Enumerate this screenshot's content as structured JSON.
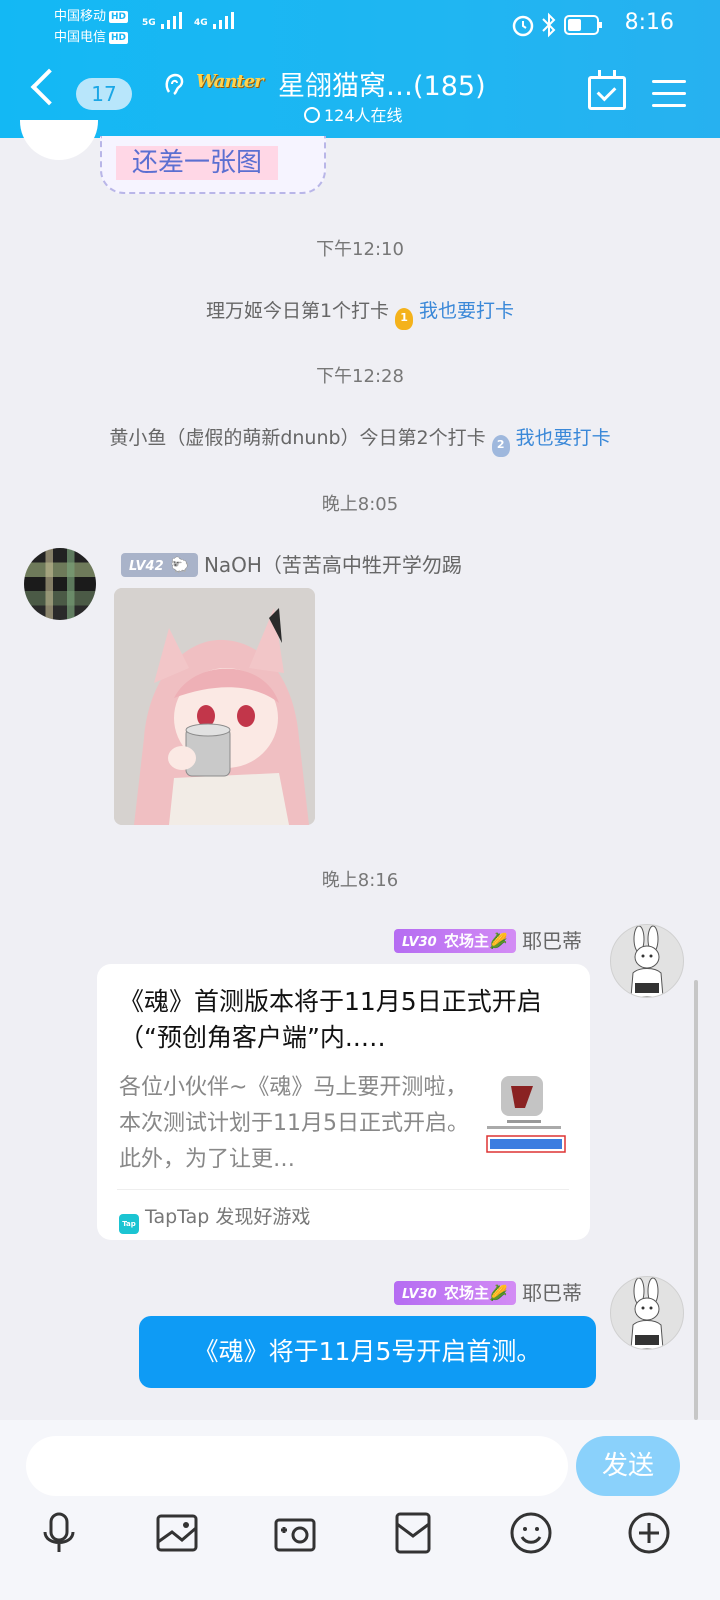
{
  "status_bar": {
    "carrier1": "中国移动",
    "carrier2": "中国电信",
    "hd": "HD",
    "net1": "5G",
    "net2": "4G",
    "time": "8:16"
  },
  "header": {
    "unread_count": "17",
    "badge_text": "Wanter",
    "group_title": "星翖猫窝…(185)",
    "online": "124人在线"
  },
  "sticker": {
    "text": "还差一张图"
  },
  "messages": {
    "time1": "下午12:10",
    "checkin1": {
      "text": "理万姬今日第1个打卡",
      "medal": "1",
      "link": "我也要打卡"
    },
    "time2": "下午12:28",
    "checkin2": {
      "text": "黄小鱼（虚假的萌新dnunb）今日第2个打卡",
      "medal": "2",
      "link": "我也要打卡"
    },
    "time3": "晚上8:05",
    "naoh": {
      "level": "LV42",
      "name": "NaOH（苦苦高中牲开学勿踢"
    },
    "time4": "晚上8:16",
    "ye1": {
      "level": "LV30",
      "title": "农场主",
      "name": "耶巴蒂"
    },
    "card": {
      "title": "《魂》首测版本将于11月5日正式开启（“预创角客户端”内..…",
      "desc": "各位小伙伴~《魂》马上要开测啦，本次测试计划于11月5日正式开启。此外，为了让更…",
      "source": "TapTap 发现好游戏",
      "tap_icon": "Tap"
    },
    "ye2": {
      "level": "LV30",
      "title": "农场主",
      "name": "耶巴蒂"
    },
    "bubble": "《魂》将于11月5号开启首测。"
  },
  "input": {
    "send_label": "发送"
  },
  "icons": [
    "mic-icon",
    "image-icon",
    "camera-icon",
    "red-packet-icon",
    "emoji-icon",
    "plus-icon"
  ],
  "colors": {
    "header_blue": "#1fb6f2",
    "bubble_blue": "#0e9bf5",
    "link_blue": "#3a88d8",
    "send_disabled": "#8ad1fb"
  }
}
